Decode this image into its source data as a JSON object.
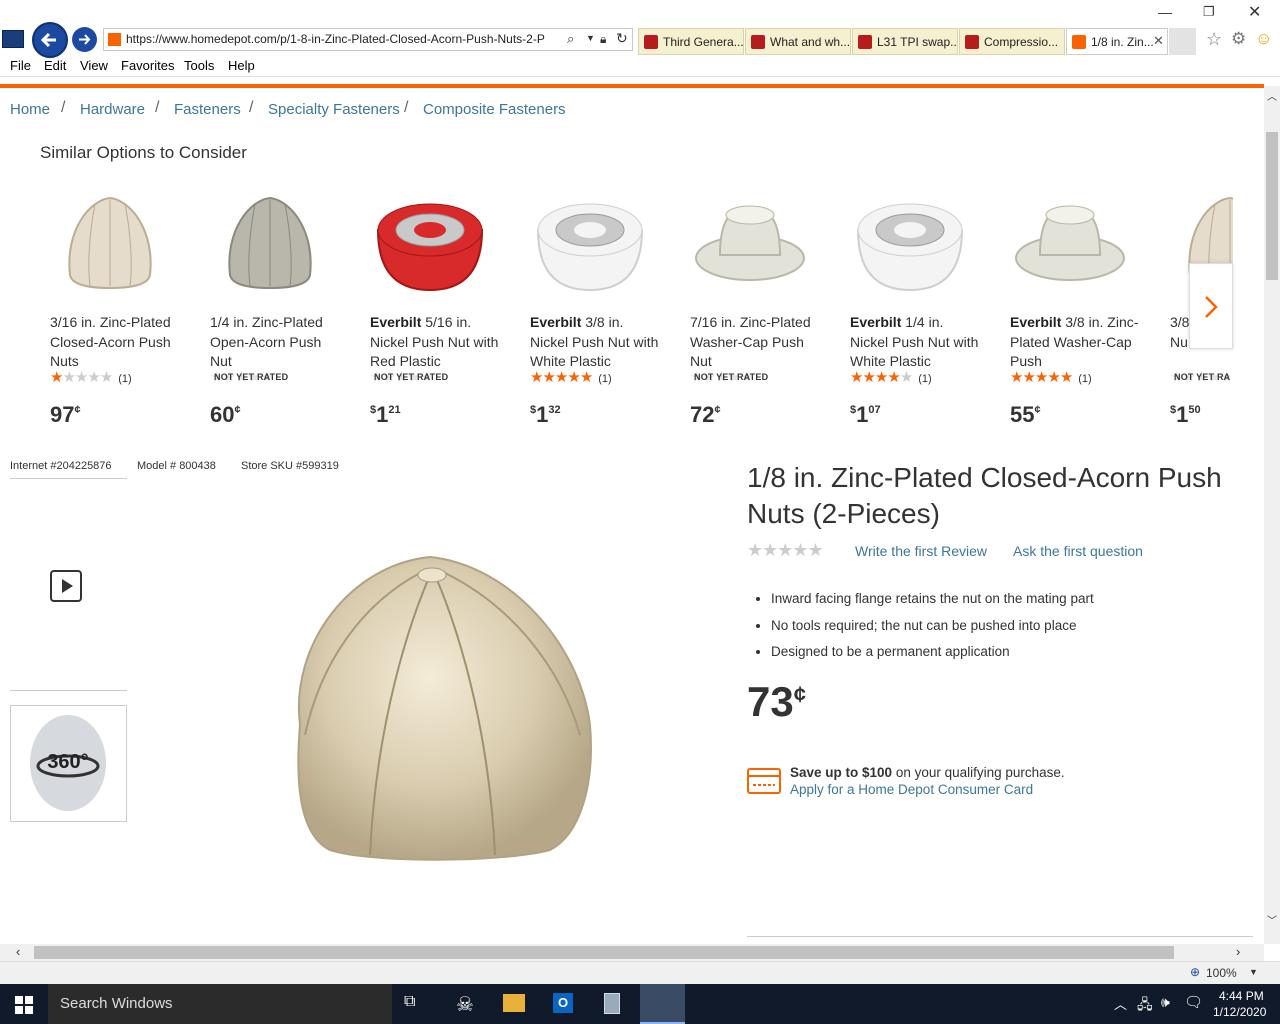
{
  "browser": {
    "url": "https://www.homedepot.com/p/1-8-in-Zinc-Plated-Closed-Acorn-Push-Nuts-2-P",
    "tabs": [
      "Third Genera...",
      "What and wh...",
      "L31 TPI swap...",
      "Compressio...",
      "1/8 in. Zin..."
    ],
    "menu": [
      "File",
      "Edit",
      "View",
      "Favorites",
      "Tools",
      "Help"
    ],
    "zoom": "100%"
  },
  "breadcrumb": [
    "Home",
    "Hardware",
    "Fasteners",
    "Specialty Fasteners",
    "Composite Fasteners"
  ],
  "breadcrumb_sep": "/",
  "similar": {
    "heading": "Similar Options to Consider",
    "items": [
      {
        "brand": "",
        "title": "3/16 in. Zinc-Plated Closed-Acorn Push Nuts",
        "rating": 1,
        "count": "(1)",
        "nyr": "",
        "dollars": "",
        "cents": "97",
        "unit": "¢"
      },
      {
        "brand": "",
        "title": "1/4 in. Zinc-Plated Open-Acorn Push Nut",
        "rating": 0,
        "count": "",
        "nyr": "NOT YET RATED",
        "dollars": "",
        "cents": "60",
        "unit": "¢"
      },
      {
        "brand": "Everbilt",
        "title": " 5/16 in. Nickel Push Nut with Red Plastic",
        "rating": 0,
        "count": "",
        "nyr": "NOT YET RATED",
        "dollars": "1",
        "cents": "21",
        "unit": "$"
      },
      {
        "brand": "Everbilt",
        "title": " 3/8 in. Nickel Push Nut with White Plastic",
        "rating": 5,
        "count": "(1)",
        "nyr": "",
        "dollars": "1",
        "cents": "32",
        "unit": "$"
      },
      {
        "brand": "",
        "title": "7/16 in. Zinc-Plated Washer-Cap Push Nut",
        "rating": 0,
        "count": "",
        "nyr": "NOT YET RATED",
        "dollars": "",
        "cents": "72",
        "unit": "¢"
      },
      {
        "brand": "Everbilt",
        "title": " 1/4 in. Nickel Push Nut with White Plastic",
        "rating": 4,
        "count": "(1)",
        "nyr": "",
        "dollars": "1",
        "cents": "07",
        "unit": "$"
      },
      {
        "brand": "Everbilt",
        "title": " 3/8 in. Zinc-Plated Washer-Cap Push",
        "rating": 5,
        "count": "(1)",
        "nyr": "",
        "dollars": "",
        "cents": "55",
        "unit": "¢"
      },
      {
        "brand": "",
        "title": "3/8 Nu",
        "rating": 0,
        "count": "",
        "nyr": "NOT YET RA",
        "dollars": "1",
        "cents": "50",
        "unit": "$"
      }
    ]
  },
  "ids": {
    "internet": "Internet #204225876",
    "model": "Model # 800438",
    "sku": "Store SKU #599319"
  },
  "product": {
    "title": "1/8 in. Zinc-Plated Closed-Acorn Push Nuts (2-Pieces)",
    "write_review": "Write the first Review",
    "ask_question": "Ask the first question",
    "bullets": [
      "Inward facing flange retains the nut on the mating part",
      "No tools required; the nut can be pushed into place",
      "Designed to be a permanent application"
    ],
    "price": "73",
    "price_unit": "¢",
    "card_save_bold": "Save up to $100",
    "card_save_rest": " on your qualifying purchase.",
    "card_apply": "Apply for a Home Depot Consumer Card"
  },
  "taskbar": {
    "search": "Search Windows",
    "time": "4:44 PM",
    "date": "1/12/2020"
  }
}
